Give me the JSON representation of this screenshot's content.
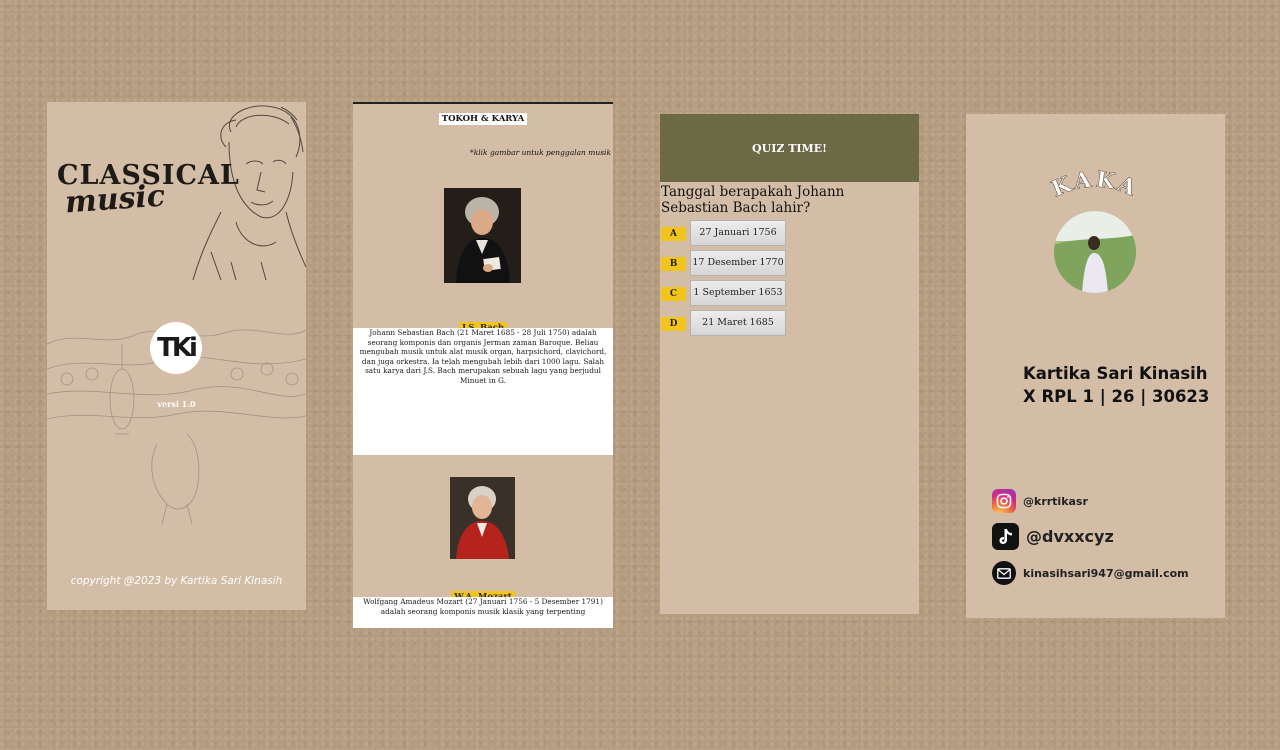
{
  "splash": {
    "title_line1": "CLASSICAL",
    "title_line2": "music",
    "logo_text": "TKi",
    "version": "versi 1.0",
    "copyright": "copyright @2023 by Kartika Sari Kinasih"
  },
  "figures": {
    "header": "TOKOH & KARYA",
    "hint": "*klik gambar untuk penggalan musik",
    "items": [
      {
        "name": "J.S. Bach",
        "bio": "Johann Sebastian Bach (21 Maret 1685 - 28 Juli 1750) adalah seorang komponis dan organis Jerman zaman Baroque. Beliau mengubah musik untuk alat musik organ, harpsichord, clavichord, dan juga orkestra. Ia telah mengubah lebih dari 1000 lagu. Salah satu karya dari J.S. Bach merupakan sebuah lagu yang berjudul Minuet in G."
      },
      {
        "name": "W.A. Mozart",
        "bio": "Wolfgang Amadeus Mozart (27 Januari 1756 - 5 Desember 1791) adalah seorang komponis musik klasik yang terpenting"
      }
    ]
  },
  "quiz": {
    "header": "QUIZ TIME!",
    "question": "Tanggal berapakah Johann Sebastian Bach lahir?",
    "options": [
      {
        "letter": "A",
        "text": "27 Januari 1756"
      },
      {
        "letter": "B",
        "text": "17 Desember 1770"
      },
      {
        "letter": "C",
        "text": "1 September 1653"
      },
      {
        "letter": "D",
        "text": "21 Maret 1685"
      }
    ]
  },
  "profile": {
    "brand": "KAKA",
    "name": "Kartika Sari Kinasih",
    "class_info": "X RPL 1 | 26 | 30623",
    "socials": [
      {
        "icon": "instagram-icon",
        "handle": "@krrtikasr"
      },
      {
        "icon": "tiktok-icon",
        "handle": "@dvxxcyz"
      },
      {
        "icon": "email-icon",
        "handle": "kinasihsari947@gmail.com"
      }
    ]
  },
  "colors": {
    "background": "#b59b7e",
    "screen": "#d4bda7",
    "accent_yellow": "#f2c51c",
    "quiz_header": "#6c6a45"
  }
}
